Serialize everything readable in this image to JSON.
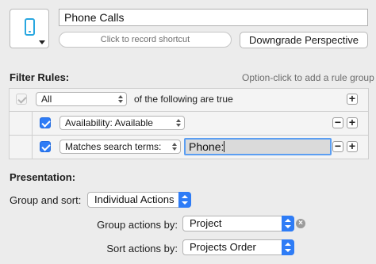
{
  "header": {
    "icon": "phone-icon",
    "title_value": "Phone Calls",
    "shortcut_label": "Click to record shortcut",
    "downgrade_label": "Downgrade Perspective"
  },
  "filter": {
    "section_label": "Filter Rules:",
    "hint": "Option-click to add a rule group",
    "root_rule": {
      "selected": "All",
      "suffix": "of the following are true"
    },
    "rules": [
      {
        "selected": "Availability: Available"
      },
      {
        "selected": "Matches search terms:",
        "search_value": "Phone:"
      }
    ],
    "plus": "+",
    "minus": "−"
  },
  "presentation": {
    "section_label": "Presentation:",
    "group_sort_label": "Group and sort:",
    "group_sort_value": "Individual Actions",
    "group_by_label": "Group actions by:",
    "group_by_value": "Project",
    "sort_by_label": "Sort actions by:",
    "sort_by_value": "Projects Order",
    "clear_glyph": "×"
  },
  "colors": {
    "accent": "#2e7cf6",
    "icon": "#29a7e0"
  }
}
